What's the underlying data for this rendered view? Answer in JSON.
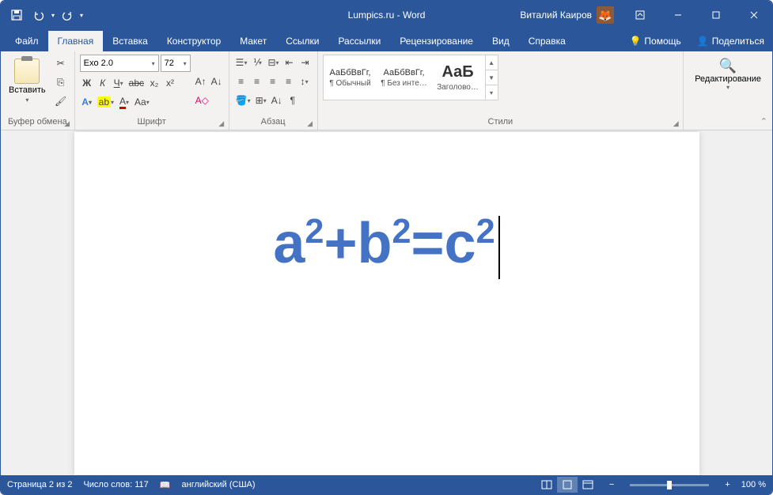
{
  "title": "Lumpics.ru - Word",
  "user": "Виталий Каиров",
  "tabs": {
    "file": "Файл",
    "home": "Главная",
    "insert": "Вставка",
    "design": "Конструктор",
    "layout": "Макет",
    "references": "Ссылки",
    "mailings": "Рассылки",
    "review": "Рецензирование",
    "view": "Вид",
    "help": "Справка",
    "tell_me": "Помощь",
    "share": "Поделиться"
  },
  "ribbon": {
    "clipboard_label": "Буфер обмена",
    "paste_label": "Вставить",
    "font_label": "Шрифт",
    "font_name": "Exo 2.0",
    "font_size": "72",
    "paragraph_label": "Абзац",
    "styles_label": "Стили",
    "style1_preview": "АаБбВвГг,",
    "style1_name": "¶ Обычный",
    "style2_preview": "АаБбВвГг,",
    "style2_name": "¶ Без инте…",
    "style3_preview": "АаБ",
    "style3_name": "Заголово…",
    "editing_label": "Редактирование"
  },
  "document": {
    "eq_a": "a",
    "eq_b": "b",
    "eq_c": "c",
    "sup": "2",
    "plus": "+",
    "equals": "="
  },
  "status": {
    "page": "Страница 2 из 2",
    "words": "Число слов: 117",
    "language": "английский (США)",
    "zoom": "100 %"
  }
}
